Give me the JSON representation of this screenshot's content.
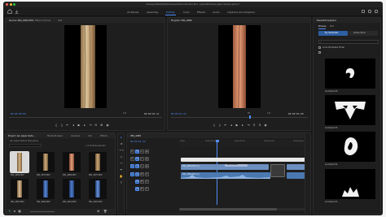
{
  "window": {
    "title": "/Users/jul/Desktop/Premiere/Adobe Premiere Pro/...ojects/Premiere paper texture.prproj *"
  },
  "workspaces": {
    "tabs": [
      {
        "label": "All Panels"
      },
      {
        "label": "Assembly"
      },
      {
        "label": "Editing"
      },
      {
        "label": "Color"
      },
      {
        "label": "Effects"
      },
      {
        "label": "Audio"
      },
      {
        "label": "Captions and Graphics"
      }
    ],
    "active_index": 2,
    "accent": "#4f8ef7"
  },
  "source_monitor": {
    "tabs": [
      "Source: IMG_4082.MOV",
      "Effect Controls",
      "Text"
    ],
    "timecode_left": "00:00:00:00",
    "timecode_right": "00:00:01:11",
    "page": "1/2"
  },
  "program_monitor": {
    "tabs": [
      "Program: IMG_4089"
    ],
    "timecode_left": "00:00:01:24",
    "timecode_right": "00:00:03:28",
    "page": "1/2",
    "zoom": "Fit"
  },
  "project": {
    "tabs": [
      "Project: Apr paper textu...",
      "Media Browser",
      "Libraries",
      "Info",
      "Effects"
    ],
    "file": "Apr paper texture SVG.prproj",
    "count": "1 of 16 items selected",
    "items": [
      {
        "label": "IMG_4082.MOV",
        "duration": "1:11"
      },
      {
        "label": "IMG_4079.MOV",
        "duration": "1:16"
      },
      {
        "label": "IMG_4089.MOV",
        "duration": "3:28"
      },
      {
        "label": "IMG_4075.MOV",
        "duration": "0:26"
      },
      {
        "label": "IMG_4087.MOV",
        "duration": "1:02"
      },
      {
        "label": "IMG_4090.MOV",
        "duration": "2:10"
      },
      {
        "label": "IMG_4091.MOV",
        "duration": "1:13"
      },
      {
        "label": "IMG_4092.MOV",
        "duration": "1:20"
      }
    ]
  },
  "timeline": {
    "tab": "IMG_4089",
    "timecode": "00:00:01:24",
    "ruler_labels": [
      "00:00",
      "00:00:01:00",
      "00:00:02:00",
      "00:00:03:00",
      "00:00:04:00"
    ],
    "tracks": {
      "video": [
        "V3",
        "V2",
        "V1"
      ],
      "audio": [
        "A1",
        "A2",
        "A3"
      ]
    },
    "clips": {
      "v1_label": "IMG_4089.MOV [V]",
      "v1_effect": "Cross Dissolve",
      "a1_label": "IMG_4089.MOV [A]"
    }
  },
  "essential_graphics": {
    "title": "Essential Graphics",
    "tabs": [
      "Browse",
      "Edit"
    ],
    "dropdown": "My Templates",
    "dropdown2": "Adobe Stock",
    "checkbox_label": "Local Templates Folder",
    "search_placeholder": "",
    "items": [
      {
        "label": "Animated 06"
      },
      {
        "label": "Animated 05"
      },
      {
        "label": "Animated 04"
      },
      {
        "label": "Animated 03"
      }
    ]
  }
}
